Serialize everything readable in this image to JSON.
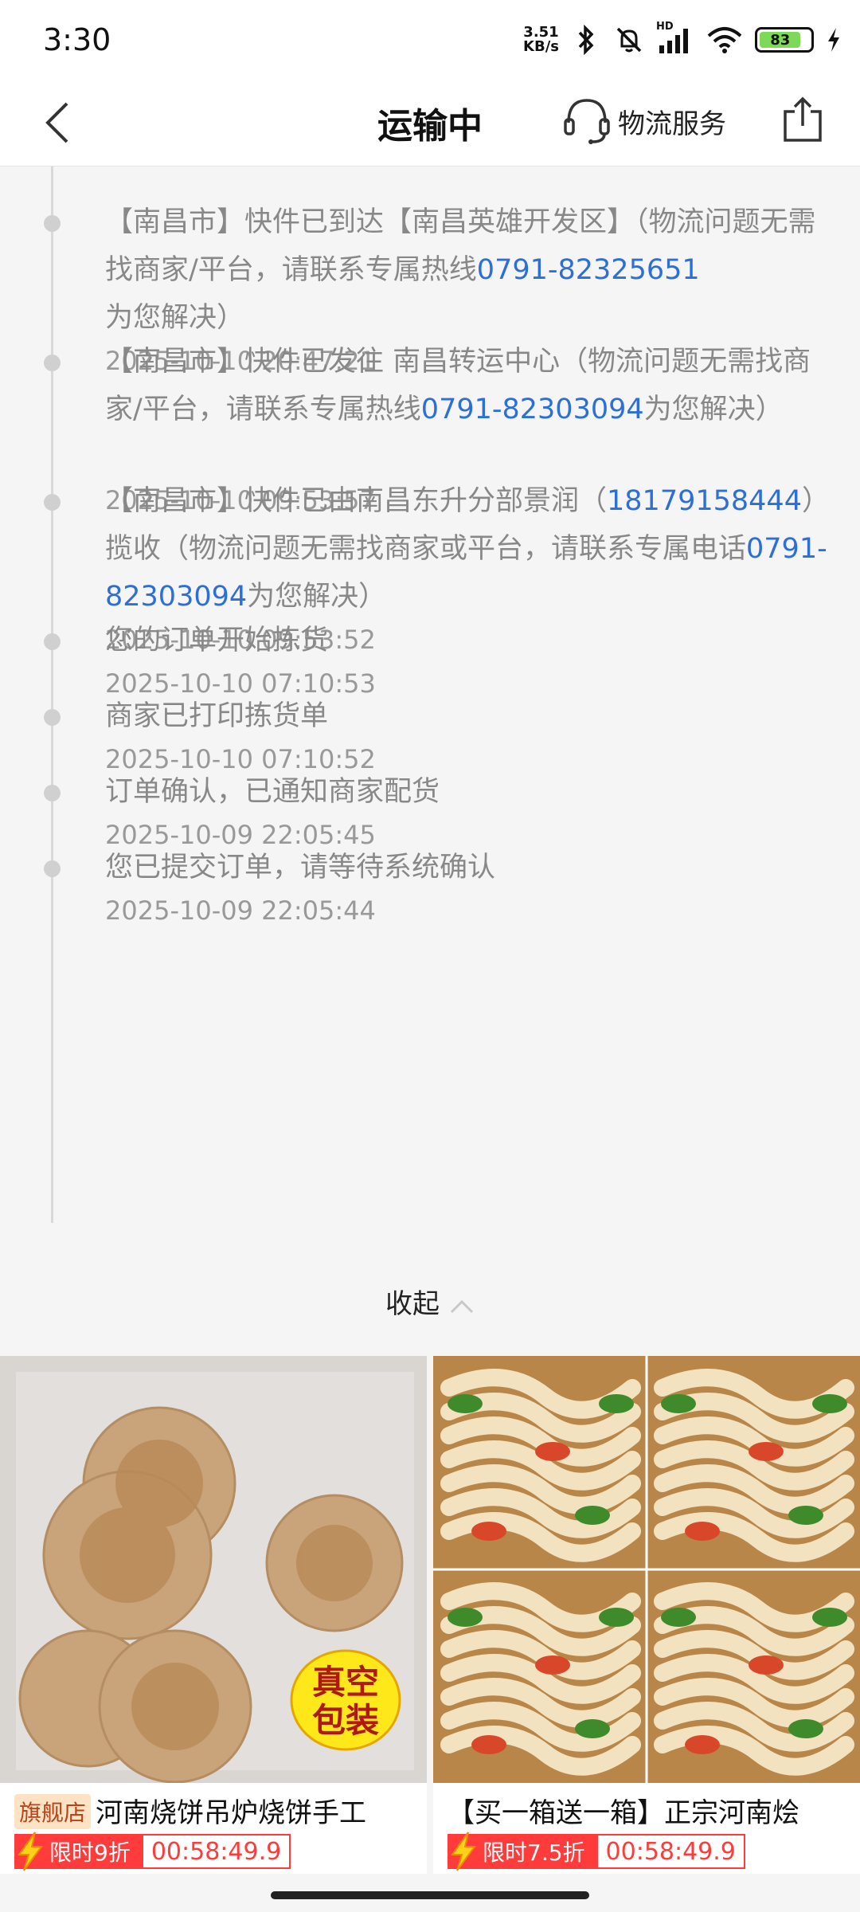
{
  "status_bar": {
    "time": "3:30",
    "net_speed_value": "3.51",
    "net_speed_unit": "KB/s",
    "battery": "83",
    "hd_label": "HD"
  },
  "header": {
    "title": "运输中",
    "service_label": "物流服务"
  },
  "timeline": [
    {
      "segments": [
        {
          "text": "【南昌市】快件已到达【南昌英雄开发区】（物流问题无需找商家/平台，请联系专属热线",
          "phone": false
        },
        {
          "text": "0791-82325651",
          "phone": true
        },
        {
          "text": "为您解决）",
          "phone": false
        }
      ],
      "time": "2025-10-10 20:47:21"
    },
    {
      "segments": [
        {
          "text": "【南昌市】快件已发往 南昌转运中心（物流问题无需找商家/平台，请联系专属热线",
          "phone": false
        },
        {
          "text": "0791-82303094",
          "phone": true
        },
        {
          "text": "为您解决）",
          "phone": false
        }
      ],
      "time": "2025-10-10 09:53:57"
    },
    {
      "segments": [
        {
          "text": "【南昌市】快件已由南昌东升分部景润（",
          "phone": false
        },
        {
          "text": "18179158444",
          "phone": true
        },
        {
          "text": "）揽收（物流问题无需找商家或平台，请联系专属电话",
          "phone": false
        },
        {
          "text": "0791-82303094",
          "phone": true
        },
        {
          "text": "为您解决）",
          "phone": false
        }
      ],
      "time": "2025-10-10 09:53:52"
    },
    {
      "segments": [
        {
          "text": "您的订单开始拣货",
          "phone": false
        }
      ],
      "time": "2025-10-10 07:10:53"
    },
    {
      "segments": [
        {
          "text": "商家已打印拣货单",
          "phone": false
        }
      ],
      "time": "2025-10-10 07:10:52"
    },
    {
      "segments": [
        {
          "text": "订单确认，已通知商家配货",
          "phone": false
        }
      ],
      "time": "2025-10-09 22:05:45"
    },
    {
      "segments": [
        {
          "text": "您已提交订单，请等待系统确认",
          "phone": false
        }
      ],
      "time": "2025-10-09 22:05:44"
    }
  ],
  "collapse_label": "收起",
  "products": [
    {
      "badge": "旗舰店",
      "title": "河南烧饼吊炉烧饼手工",
      "promo": "限时9折",
      "countdown": "00:58:49.9",
      "image_sticker": [
        "真空",
        "包装"
      ]
    },
    {
      "badge": "",
      "title": "【买一箱送一箱】正宗河南烩",
      "promo": "限时7.5折",
      "countdown": "00:58:49.9"
    }
  ],
  "colors": {
    "link_blue": "#2c6fd8",
    "promo_red": "#ff3b3b",
    "badge_bg": "#fde3c4"
  }
}
